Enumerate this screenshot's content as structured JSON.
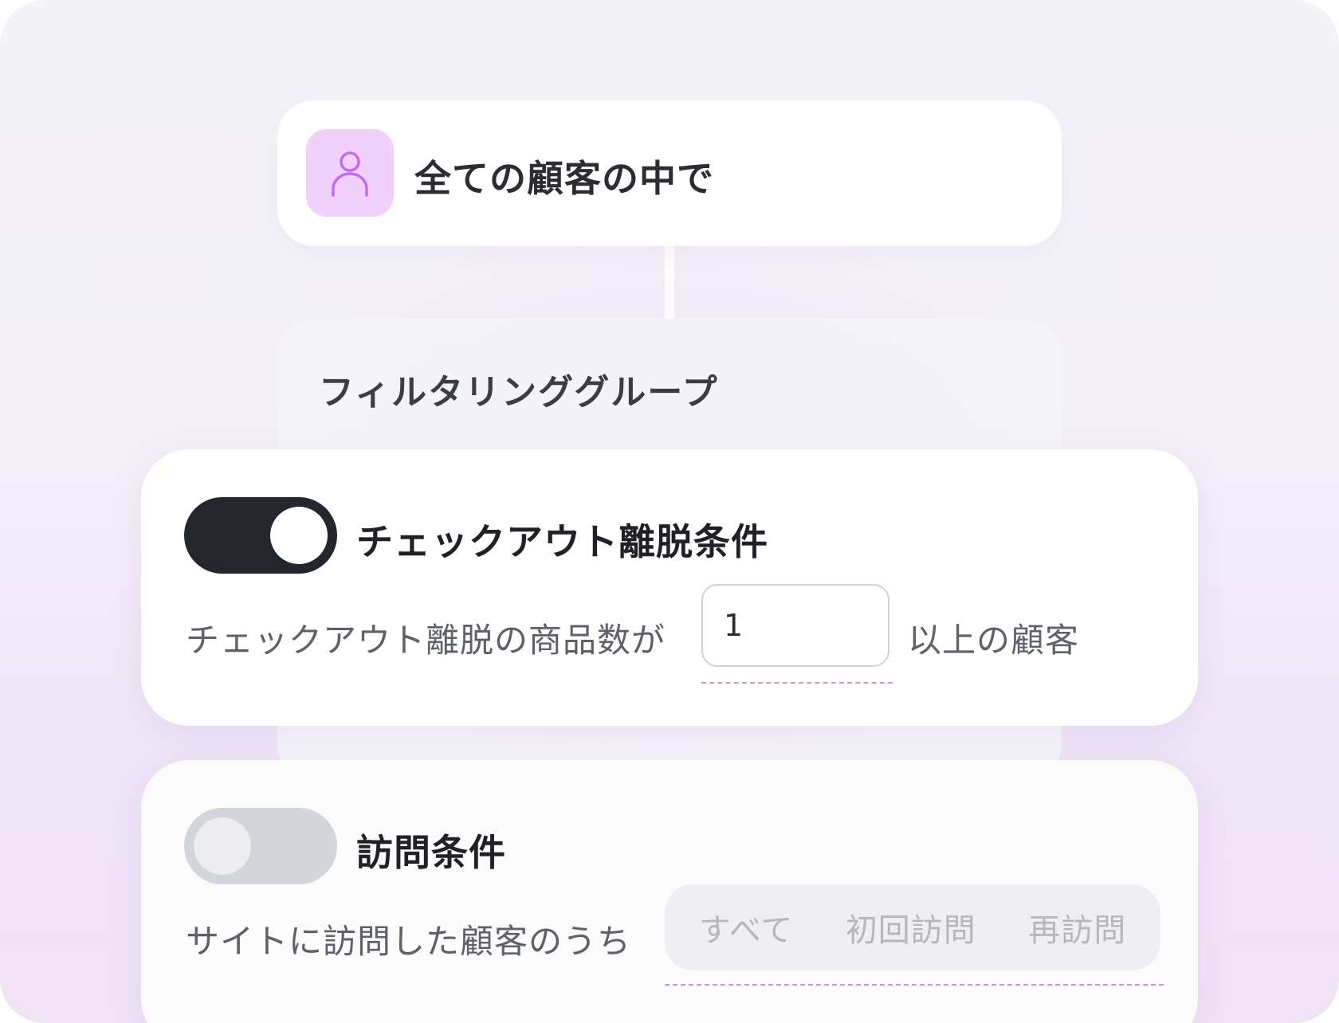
{
  "audience": {
    "title": "全ての顧客の中で",
    "icon": "user-icon"
  },
  "filter_group": {
    "title": "フィルタリンググループ"
  },
  "conditions": [
    {
      "title": "チェックアウト離脱条件",
      "enabled": true,
      "prefix_text": "チェックアウト離脱の商品数が",
      "input_value": "1",
      "suffix_text": "以上の顧客"
    },
    {
      "title": "訪問条件",
      "enabled": false,
      "prefix_text": "サイトに訪問した顧客のうち",
      "options": [
        "すべて",
        "初回訪問",
        "再訪問"
      ]
    }
  ],
  "colors": {
    "accent": "#d38cf0",
    "avatar_bg": "#f1d0fb",
    "toggle_on": "#23262c",
    "toggle_off": "#d2d5d9"
  }
}
